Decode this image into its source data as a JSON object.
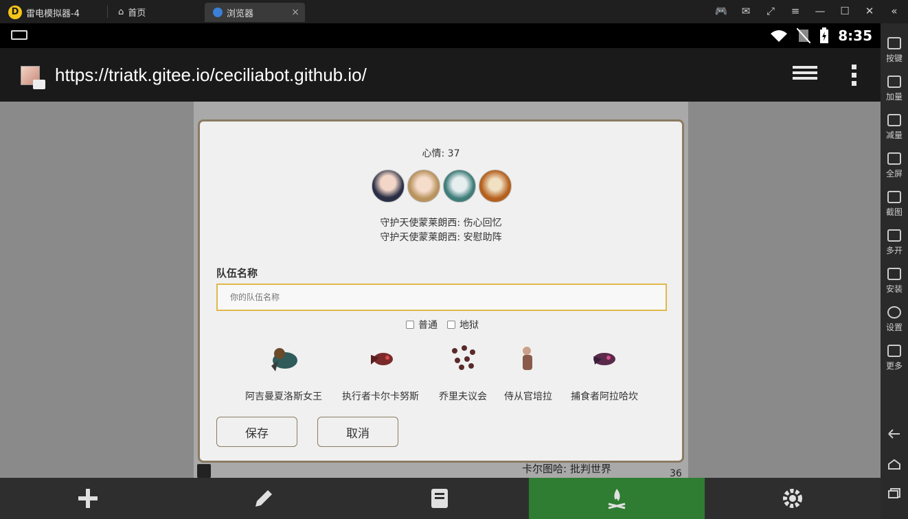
{
  "emulator": {
    "title": "雷电模拟器-4",
    "tabs": [
      {
        "label": "首页"
      },
      {
        "label": "浏览器"
      }
    ],
    "tab_close": "×",
    "controls": {
      "gamepad": "🎮",
      "mail": "✉",
      "popout": "⤢",
      "menu": "≡",
      "minimize": "—",
      "maximize": "☐",
      "close": "✕",
      "collapse": "«"
    }
  },
  "status": {
    "time": "8:35"
  },
  "browser": {
    "url": "https://triatk.gitee.io/ceciliabot.github.io/"
  },
  "background_page": {
    "text_1": "卡尔图哈: 批判世界",
    "text_2": "36"
  },
  "modal": {
    "mood": "心情: 37",
    "skills": [
      "守护天使蒙莱朗西: 伤心回忆",
      "守护天使蒙莱朗西: 安慰助阵"
    ],
    "team_label": "队伍名称",
    "team_placeholder": "你的队伍名称",
    "modes": [
      "普通",
      "地狱"
    ],
    "bosses": [
      {
        "name": "阿吉曼夏洛斯女王"
      },
      {
        "name": "执行者卡尔卡努斯"
      },
      {
        "name": "乔里夫议会"
      },
      {
        "name": "侍从官培拉"
      },
      {
        "name": "捕食者阿拉哈坎"
      }
    ],
    "save_label": "保存",
    "cancel_label": "取消"
  },
  "right_rail": [
    {
      "label": "按键"
    },
    {
      "label": "加量"
    },
    {
      "label": "减量"
    },
    {
      "label": "全屏"
    },
    {
      "label": "截图"
    },
    {
      "label": "多开"
    },
    {
      "label": "安装"
    },
    {
      "label": "设置"
    },
    {
      "label": "更多"
    }
  ],
  "colors": {
    "active_nav": "#2e7d32",
    "modal_border": "#8b7b62",
    "input_border": "#e0b84a"
  }
}
